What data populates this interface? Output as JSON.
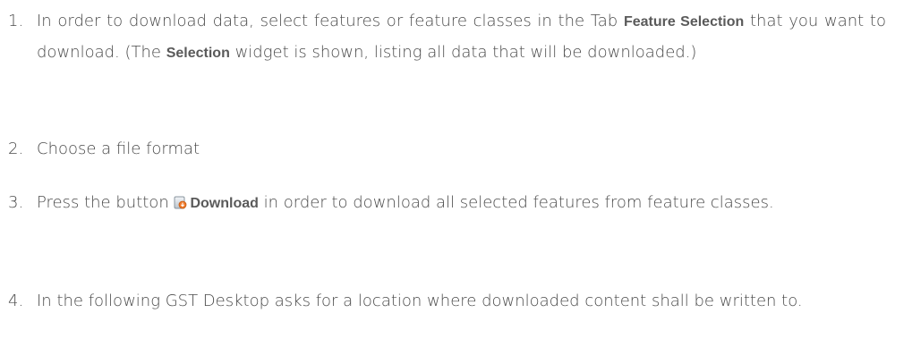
{
  "steps": [
    {
      "number": "1.",
      "parts": [
        "In order to download data, select features or feature classes in the Tab ",
        "Feature Selection",
        " that you want to download. (The ",
        "Selection",
        " widget is shown, listing all data that will be downloaded.)"
      ]
    },
    {
      "number": "2.",
      "parts": [
        "Choose a file format"
      ]
    },
    {
      "number": "3.",
      "parts": [
        "Press the button ",
        "Download",
        " in order to download all selected features from feature classes."
      ],
      "icon": "download-icon"
    },
    {
      "number": "4.",
      "parts": [
        "In the following GST Desktop asks for a location where downloaded content shall be written to."
      ]
    }
  ]
}
